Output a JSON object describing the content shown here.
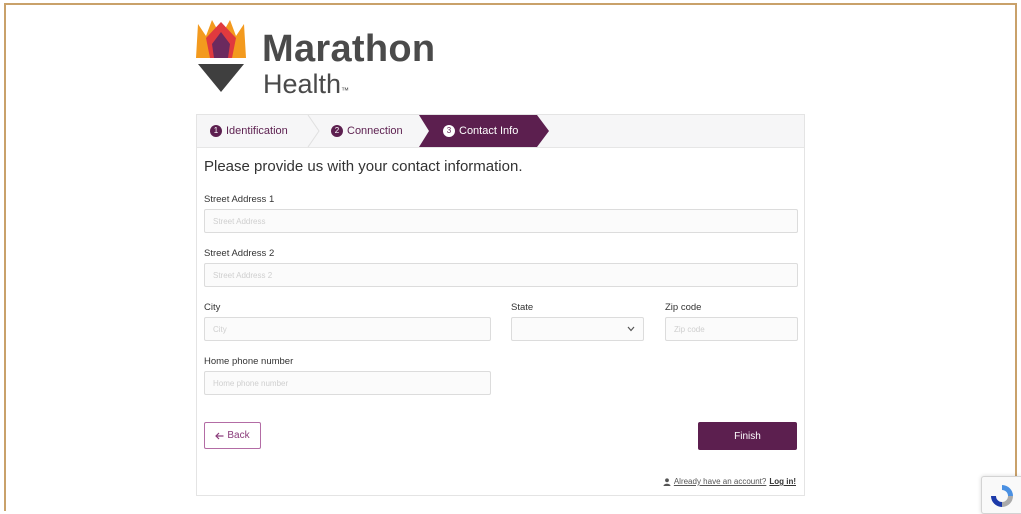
{
  "brand": {
    "name_line1": "Marathon",
    "name_line2": "Health",
    "trademark": "™",
    "colors": {
      "primary": "#5c1f4f",
      "flame_orange": "#f39a1e",
      "flame_red": "#e03a3e",
      "flame_purple": "#6b2a5e",
      "text_dark": "#4a4a4a"
    }
  },
  "wizard": {
    "steps": [
      {
        "number": "1",
        "label": "Identification",
        "state": "complete"
      },
      {
        "number": "2",
        "label": "Connection",
        "state": "complete"
      },
      {
        "number": "3",
        "label": "Contact Info",
        "state": "active"
      }
    ]
  },
  "form": {
    "heading": "Please provide us with your contact information.",
    "street1": {
      "label": "Street Address 1",
      "placeholder": "Street Address",
      "value": ""
    },
    "street2": {
      "label": "Street Address 2",
      "placeholder": "Street Address 2",
      "value": ""
    },
    "city": {
      "label": "City",
      "placeholder": "City",
      "value": ""
    },
    "state": {
      "label": "State",
      "value": ""
    },
    "zip": {
      "label": "Zip code",
      "placeholder": "Zip code",
      "value": ""
    },
    "phone": {
      "label": "Home phone number",
      "placeholder": "Home phone number",
      "value": ""
    }
  },
  "actions": {
    "back_label": "Back",
    "back_icon": "arrow-left-icon",
    "finish_label": "Finish"
  },
  "footer": {
    "login_prompt": "Already have an account?",
    "login_link": "Log in!",
    "user_icon": "user-icon"
  },
  "recaptcha": {
    "icon": "recaptcha-icon"
  }
}
